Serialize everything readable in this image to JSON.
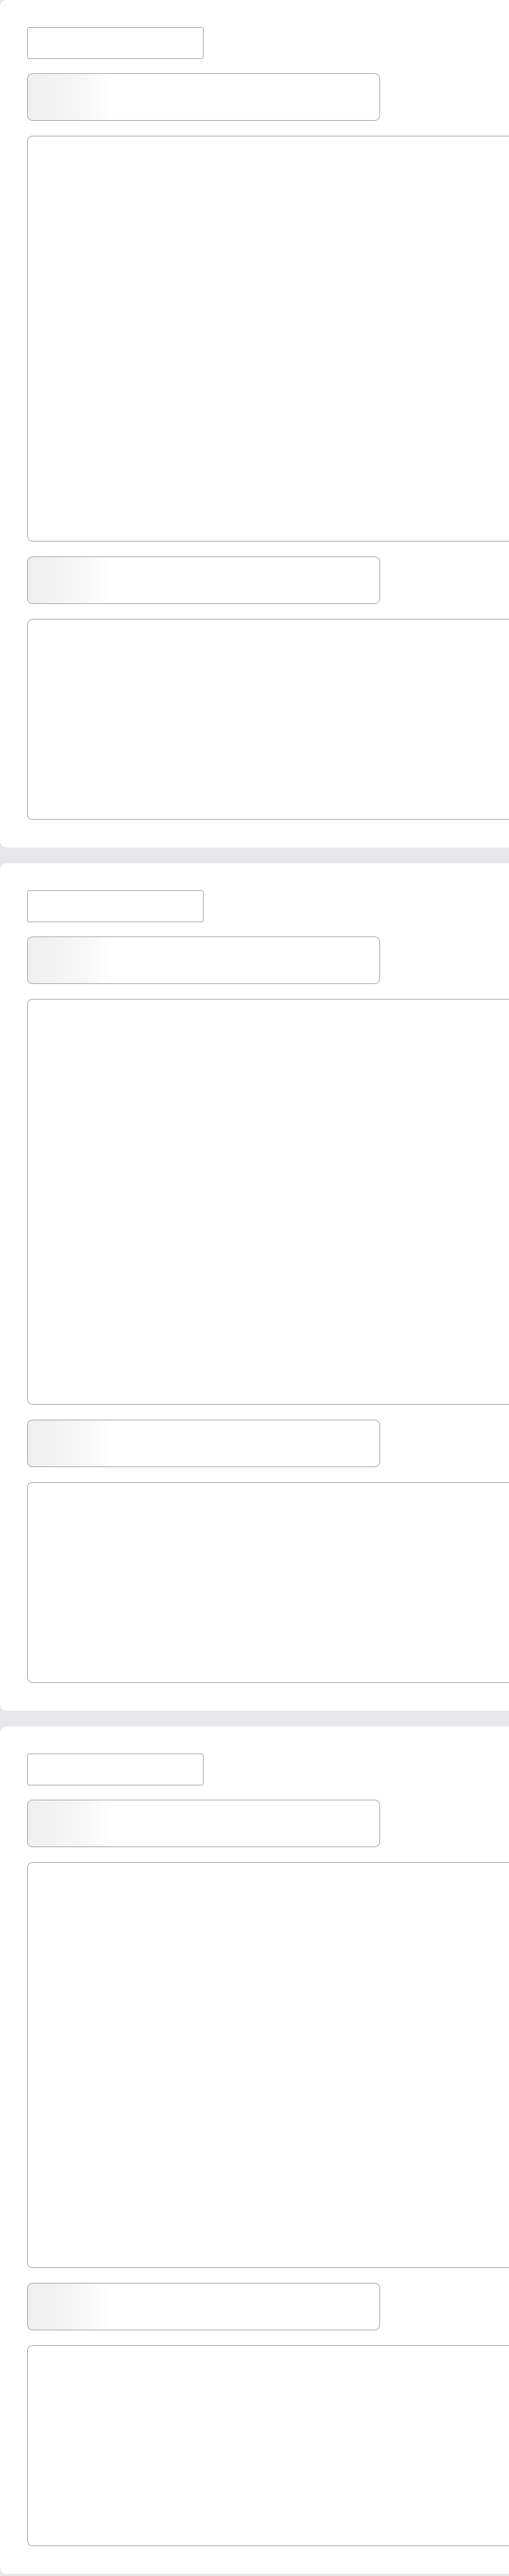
{
  "cards": [
    {
      "label_placeholder": "",
      "section_a_title": "",
      "section_a_body": "",
      "section_b_title": "",
      "section_b_body": ""
    },
    {
      "label_placeholder": "",
      "section_a_title": "",
      "section_a_body": "",
      "section_b_title": "",
      "section_b_body": ""
    },
    {
      "label_placeholder": "",
      "section_a_title": "",
      "section_a_body": "",
      "section_b_title": "",
      "section_b_body": ""
    }
  ],
  "colors": {
    "page_background": "#e6e6eb",
    "card_background": "#ffffff",
    "placeholder_border": "#a3a3a3",
    "shimmer_start": "#efefef"
  },
  "state": "loading-skeleton"
}
